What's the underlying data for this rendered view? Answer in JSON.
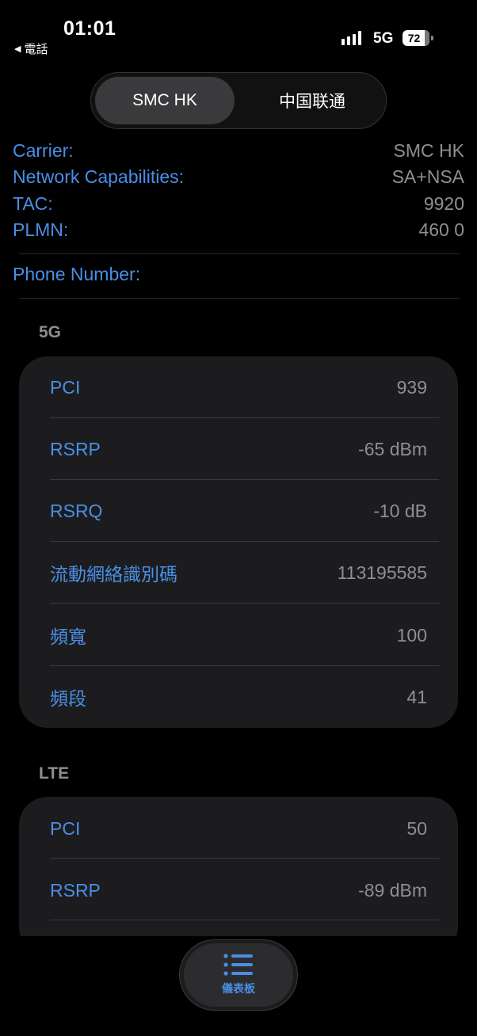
{
  "status_bar": {
    "time": "01:01",
    "back_label": "電話",
    "network": "5G",
    "battery": "72"
  },
  "segmented": {
    "tabs": [
      {
        "label": "SMC HK",
        "active": true
      },
      {
        "label": "中国联通",
        "active": false
      }
    ]
  },
  "carrier_info": {
    "rows": [
      {
        "label": "Carrier:",
        "value": "SMC HK"
      },
      {
        "label": "Network Capabilities:",
        "value": "SA+NSA"
      },
      {
        "label": "TAC:",
        "value": "9920"
      },
      {
        "label": "PLMN:",
        "value": "460 0"
      }
    ],
    "phone_label": "Phone Number:"
  },
  "sections": [
    {
      "title": "5G",
      "rows": [
        {
          "label": "PCI",
          "value": "939"
        },
        {
          "label": "RSRP",
          "value": "-65 dBm"
        },
        {
          "label": "RSRQ",
          "value": "-10 dB"
        },
        {
          "label": "流動網絡識別碼",
          "value": "113195585"
        },
        {
          "label": "頻寬",
          "value": "100"
        },
        {
          "label": "頻段",
          "value": "41"
        }
      ]
    },
    {
      "title": "LTE",
      "rows": [
        {
          "label": "PCI",
          "value": "50"
        },
        {
          "label": "RSRP",
          "value": "-89 dBm"
        }
      ]
    }
  ],
  "tab_bar": {
    "label": "儀表板",
    "icon": "list-icon",
    "accent": "#4a8ee6"
  }
}
